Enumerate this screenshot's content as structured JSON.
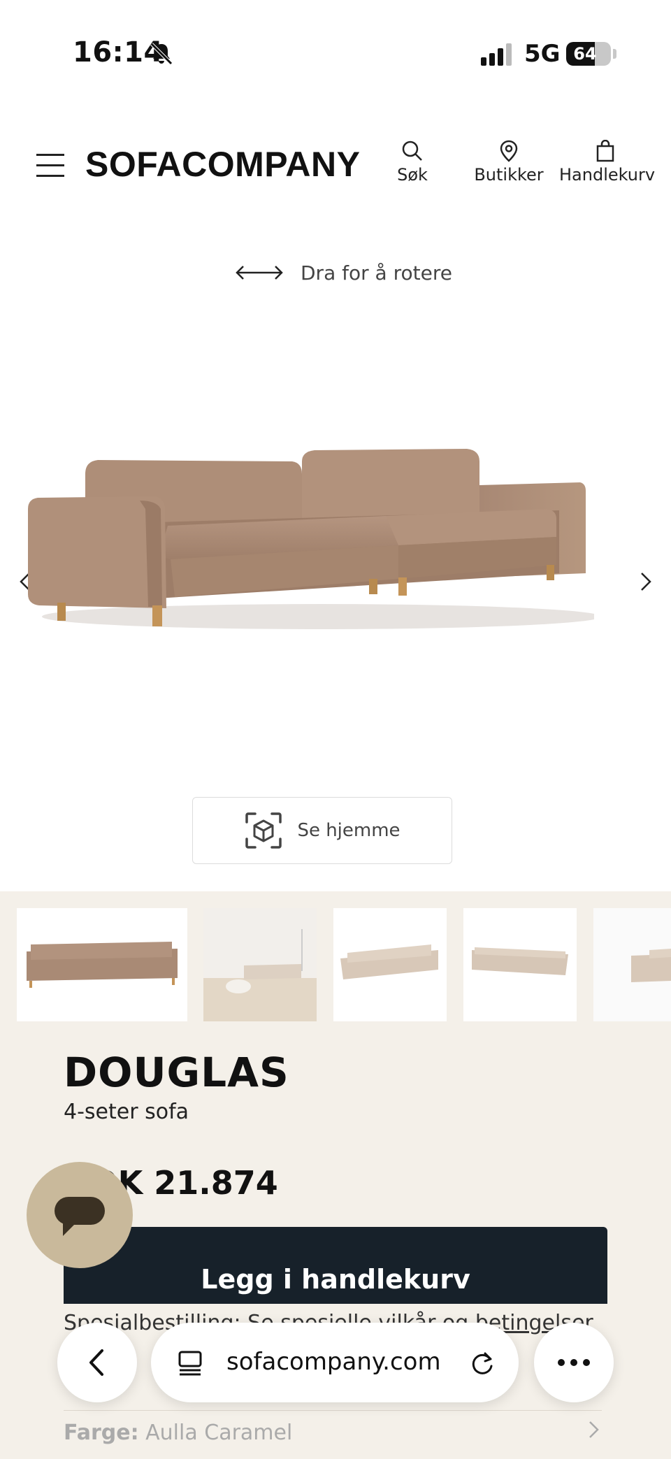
{
  "status_bar": {
    "time": "16:14",
    "network": "5G",
    "battery_level": "64",
    "battery_fraction": 0.64,
    "icons": [
      "bell-slash-icon",
      "signal-icon",
      "battery-icon"
    ]
  },
  "header": {
    "logo": "SOFACOMPANY",
    "nav": {
      "search_label": "Søk",
      "stores_label": "Butikker",
      "cart_label": "Handlekurv"
    }
  },
  "viewer": {
    "rotate_hint": "Dra for å rotere",
    "ar_button_label": "Se hjemme"
  },
  "product": {
    "name": "DOUGLAS",
    "subtitle": "4-seter sofa",
    "price": "NOK 21.874",
    "price_visible_partial": "K 21.874",
    "add_to_cart_label": "Legg i handlekurv",
    "special_order_text": "Spesialbestilling: Se spesielle vilkår og ",
    "special_order_link": "betingelser",
    "color_key": "Farge:",
    "color_value": " Aulla Caramel"
  },
  "browser": {
    "url": "sofacompany.com"
  },
  "colors": {
    "product_bg": "#f4f0e9",
    "cta_bg": "#17212a",
    "sofa": "#ad8c76",
    "chat_bubble": "#c9b99b"
  }
}
